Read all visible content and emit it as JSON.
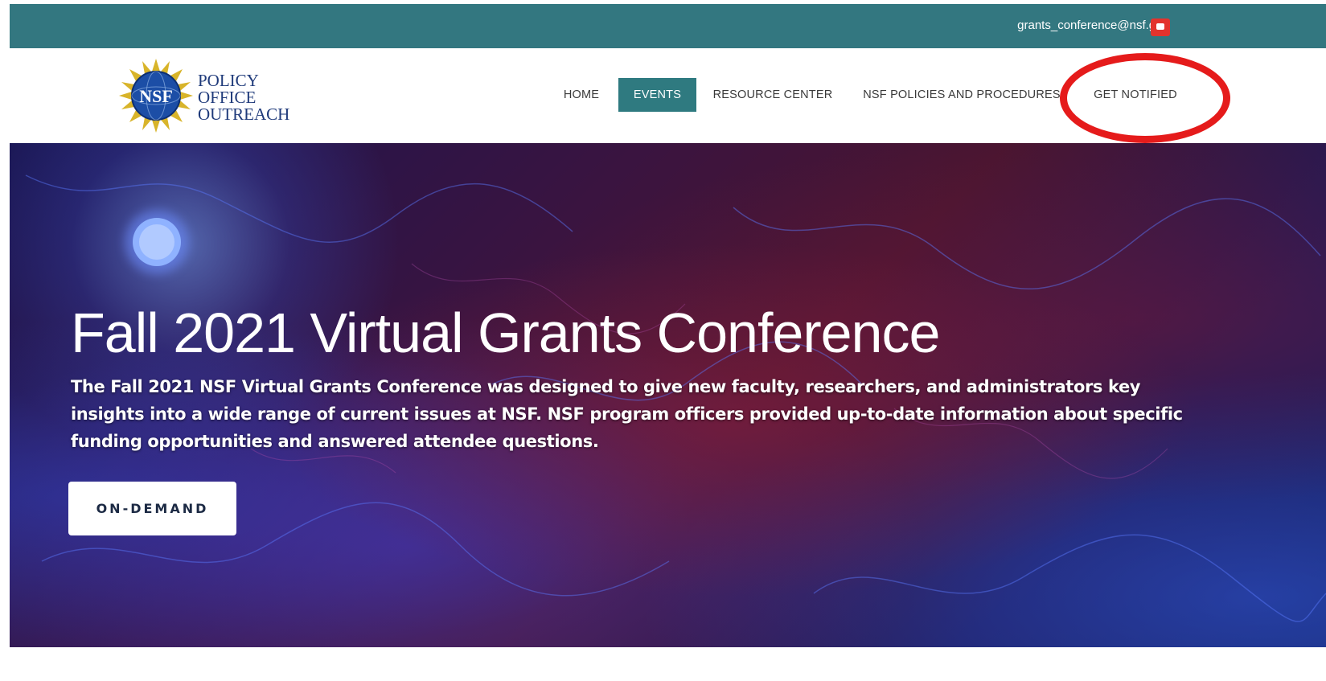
{
  "topbar": {
    "email": "grants_conference@nsf.gov",
    "social_icon": "youtube-icon",
    "background": "#337780",
    "icon_color": "#e3332d"
  },
  "logo": {
    "emblem_text": "NSF",
    "lines": [
      "POLICY",
      "OFFICE",
      "OUTREACH"
    ],
    "text_color": "#1f3a7a"
  },
  "nav": {
    "items": [
      {
        "label": "HOME"
      },
      {
        "label": "EVENTS",
        "active": true
      },
      {
        "label": "RESOURCE CENTER"
      },
      {
        "label": "NSF POLICIES AND PROCEDURES"
      },
      {
        "label": "GET NOTIFIED"
      }
    ],
    "active_color": "#2f7a80"
  },
  "hero": {
    "title": "Fall 2021 Virtual Grants Conference",
    "description": "The Fall 2021 NSF Virtual Grants Conference was designed to give new faculty, researchers, and administrators key insights into a wide range of current issues at NSF. NSF program officers provided up-to-date information about specific funding opportunities and answered attendee questions.",
    "cta_label": "ON-DEMAND"
  },
  "annotation": {
    "shape": "ellipse",
    "color": "#e51b1b",
    "target": "GET NOTIFIED"
  }
}
